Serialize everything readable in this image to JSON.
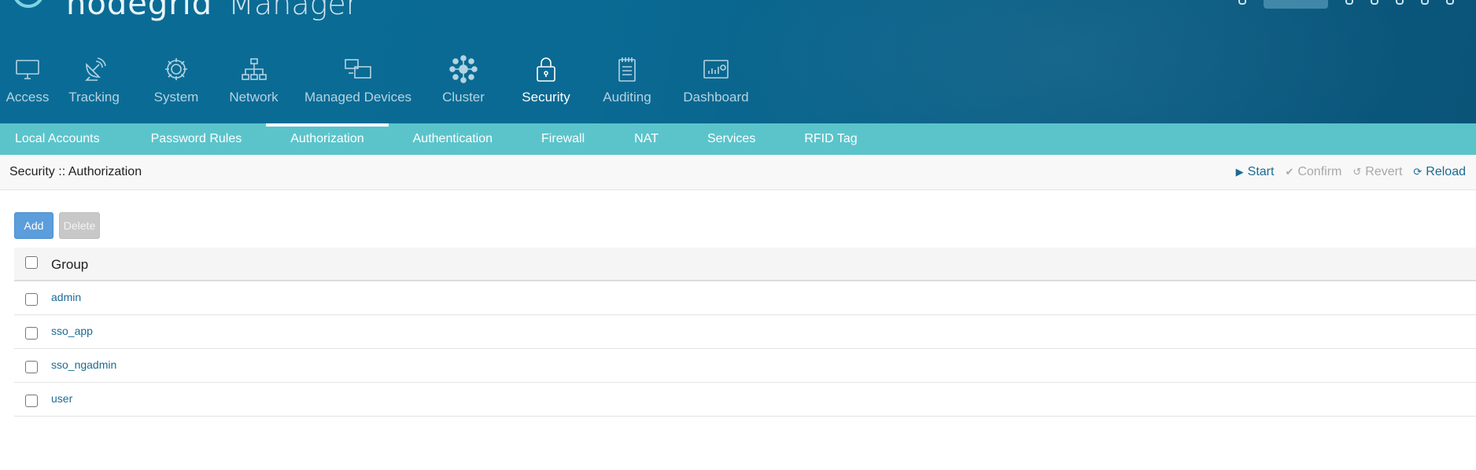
{
  "brand": {
    "name": "nodegrid",
    "product": "Manager"
  },
  "main_nav": [
    {
      "label": "Access",
      "icon": "monitor-icon",
      "active": false
    },
    {
      "label": "Tracking",
      "icon": "satellite-dish-icon",
      "active": false
    },
    {
      "label": "System",
      "icon": "gear-icon",
      "active": false
    },
    {
      "label": "Network",
      "icon": "network-tree-icon",
      "active": false
    },
    {
      "label": "Managed Devices",
      "icon": "devices-icon",
      "active": false
    },
    {
      "label": "Cluster",
      "icon": "cluster-icon",
      "active": false
    },
    {
      "label": "Security",
      "icon": "lock-icon",
      "active": true
    },
    {
      "label": "Auditing",
      "icon": "notepad-icon",
      "active": false
    },
    {
      "label": "Dashboard",
      "icon": "dashboard-icon",
      "active": false
    }
  ],
  "sub_nav": [
    {
      "label": "Local Accounts",
      "active": false
    },
    {
      "label": "Password Rules",
      "active": false
    },
    {
      "label": "Authorization",
      "active": true
    },
    {
      "label": "Authentication",
      "active": false
    },
    {
      "label": "Firewall",
      "active": false
    },
    {
      "label": "NAT",
      "active": false
    },
    {
      "label": "Services",
      "active": false
    },
    {
      "label": "RFID Tag",
      "active": false
    }
  ],
  "breadcrumb": "Security :: Authorization",
  "actions": {
    "start": {
      "label": "Start",
      "icon": "play-icon",
      "enabled": true
    },
    "confirm": {
      "label": "Confirm",
      "icon": "check-icon",
      "enabled": false
    },
    "revert": {
      "label": "Revert",
      "icon": "undo-icon",
      "enabled": false
    },
    "reload": {
      "label": "Reload",
      "icon": "refresh-icon",
      "enabled": true
    }
  },
  "buttons": {
    "add": "Add",
    "delete": "Delete"
  },
  "table": {
    "header": "Group",
    "rows": [
      "admin",
      "sso_app",
      "sso_ngadmin",
      "user"
    ]
  },
  "colors": {
    "header_bg": "#0a6a93",
    "subnav_bg": "#5bc4cb",
    "link": "#1b6b93",
    "add_button": "#5b9edb",
    "delete_button": "#c8c8c8"
  }
}
